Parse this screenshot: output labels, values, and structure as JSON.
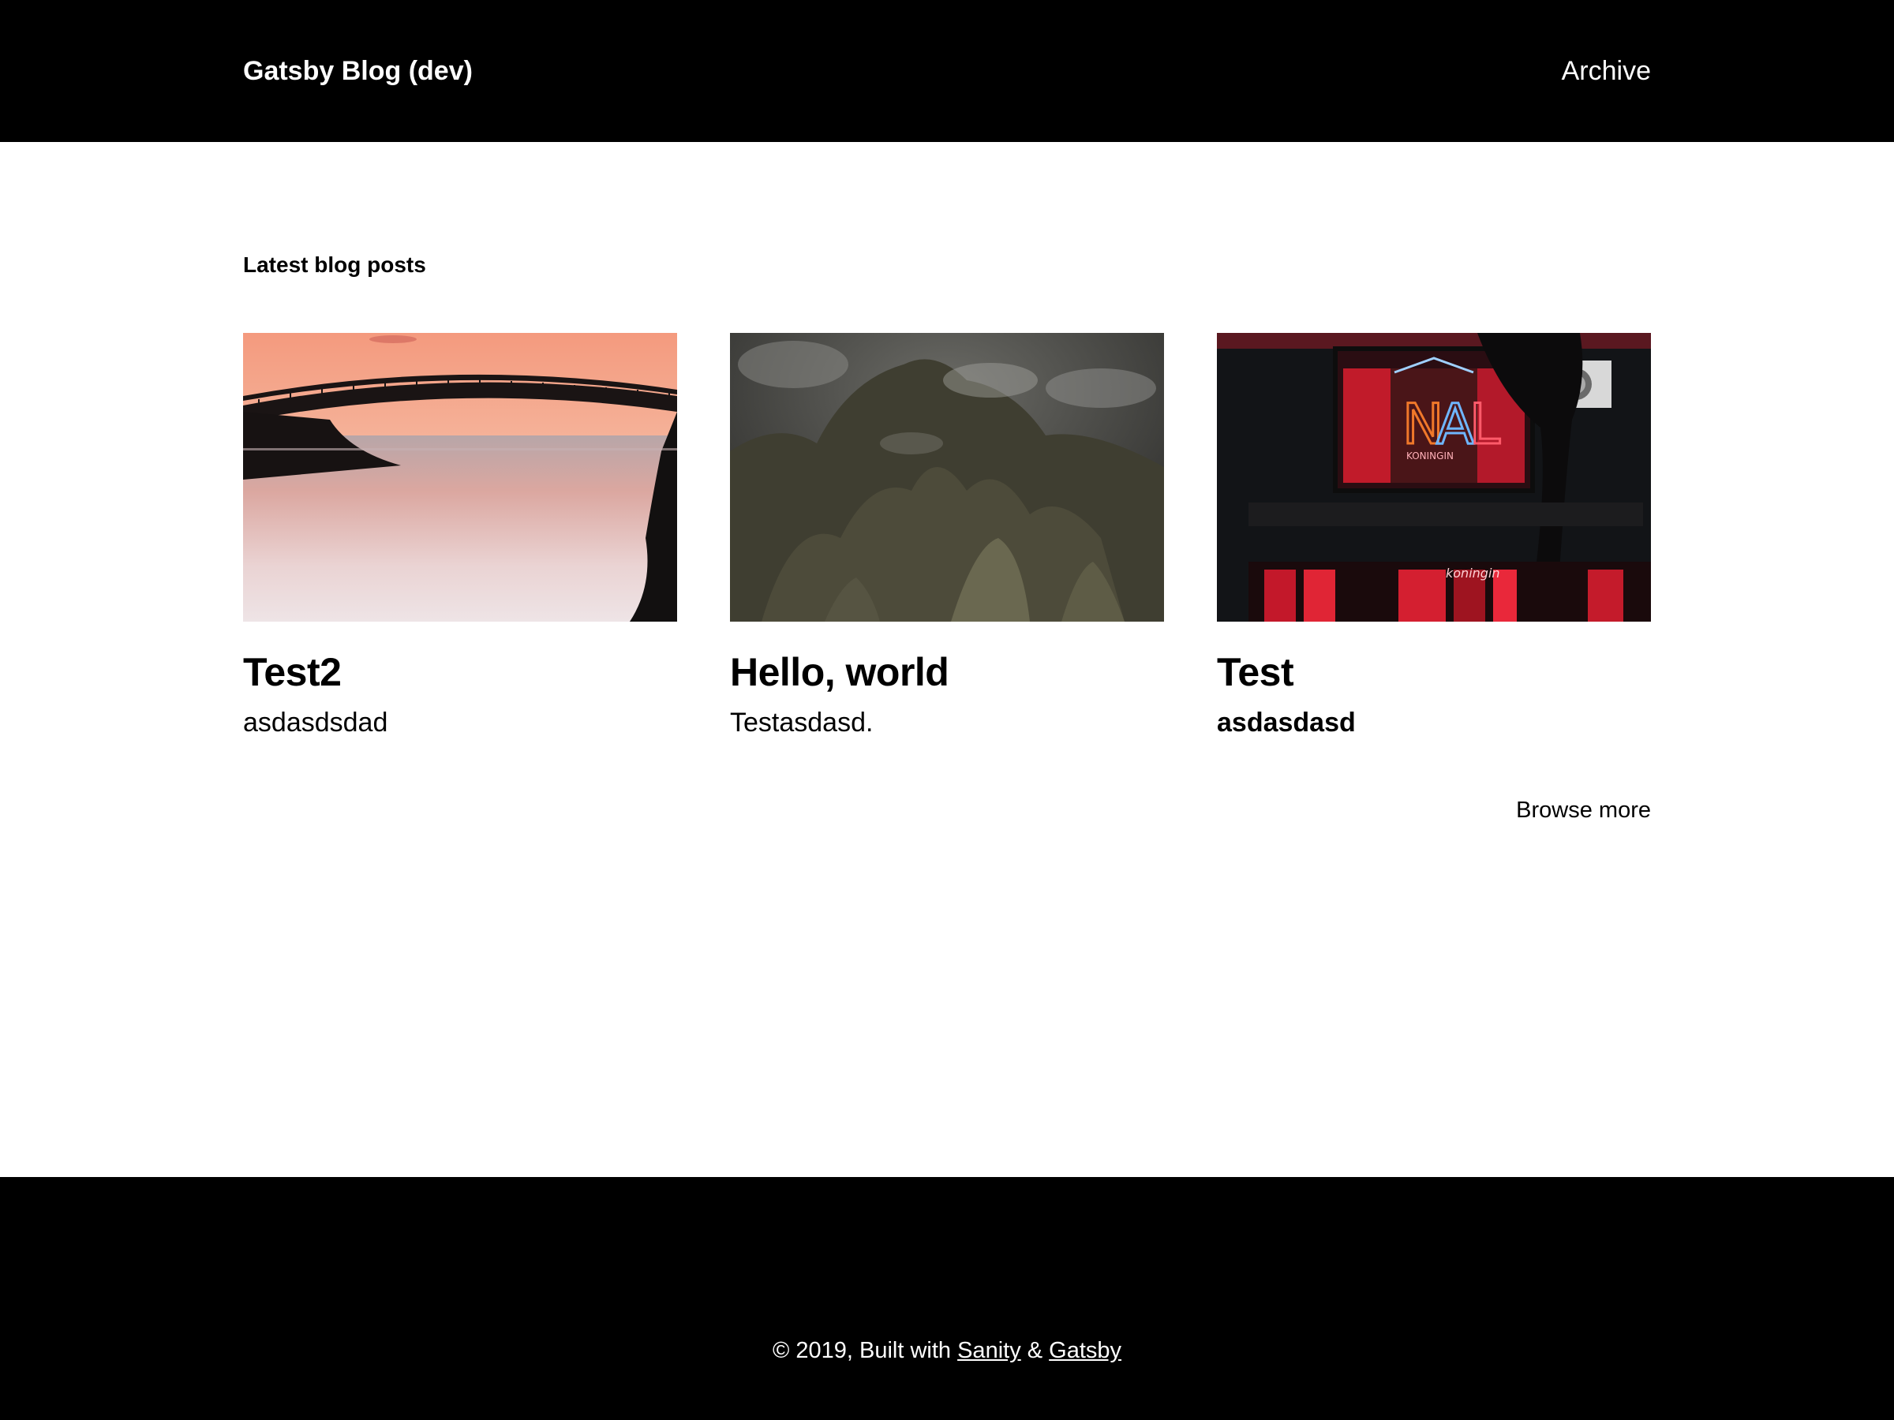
{
  "header": {
    "brand": "Gatsby Blog (dev)",
    "nav_archive": "Archive"
  },
  "main": {
    "section_title": "Latest blog posts",
    "posts": [
      {
        "title": "Test2",
        "excerpt": "asdasdsdad",
        "image": "bridge-sunset-photo"
      },
      {
        "title": "Hello, world",
        "excerpt": "Testasdasd.",
        "image": "misty-mountain-photo"
      },
      {
        "title": "Test",
        "excerpt": "asdasdasd",
        "image": "neon-storefront-photo",
        "excerpt_bold": true
      }
    ],
    "browse_more": "Browse more"
  },
  "footer": {
    "prefix": "© 2019, Built with ",
    "link_sanity": "Sanity",
    "separator": " & ",
    "link_gatsby": "Gatsby"
  },
  "colors": {
    "header_bg": "#000000",
    "footer_bg": "#000000",
    "page_bg": "#ffffff"
  }
}
